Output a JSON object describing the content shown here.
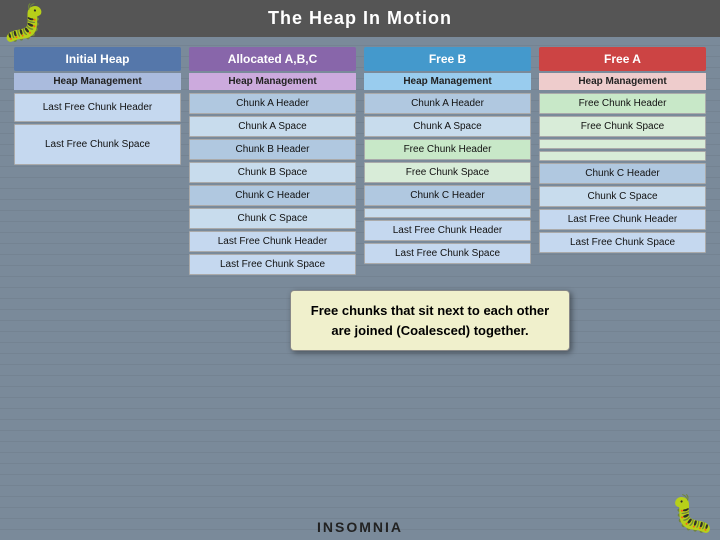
{
  "title": "The Heap In Motion",
  "columns": [
    {
      "id": "initial",
      "header": "Initial Heap",
      "header_class": "initial",
      "mgmt": "Heap Management",
      "mgmt_class": "initial",
      "cells": [
        {
          "text": "Last Free Chunk Header",
          "class": "cell light-blue tall"
        },
        {
          "text": "Last Free Chunk Space",
          "class": "cell light-blue taller"
        }
      ]
    },
    {
      "id": "allocated",
      "header": "Allocated A,B,C",
      "header_class": "allocated",
      "mgmt": "Heap Management",
      "mgmt_class": "allocated",
      "cells": [
        {
          "text": "Chunk A Header",
          "class": "cell chunk-header"
        },
        {
          "text": "Chunk A Space",
          "class": "cell chunk-space"
        },
        {
          "text": "Chunk B Header",
          "class": "cell chunk-header"
        },
        {
          "text": "Chunk B Space",
          "class": "cell chunk-space"
        },
        {
          "text": "Chunk C Header",
          "class": "cell chunk-header"
        },
        {
          "text": "Chunk C Space",
          "class": "cell chunk-space"
        },
        {
          "text": "Last Free Chunk Header",
          "class": "cell light-blue"
        },
        {
          "text": "Last Free Chunk Space",
          "class": "cell light-blue"
        }
      ]
    },
    {
      "id": "free-b",
      "header": "Free B",
      "header_class": "free-b",
      "mgmt": "Heap Management",
      "mgmt_class": "free-b",
      "cells": [
        {
          "text": "Chunk A Header",
          "class": "cell chunk-header"
        },
        {
          "text": "Chunk A Space",
          "class": "cell chunk-space"
        },
        {
          "text": "Free Chunk Header",
          "class": "cell free-chunk-header"
        },
        {
          "text": "Free Chunk Space",
          "class": "cell free-chunk-space"
        },
        {
          "text": "Chunk C Header",
          "class": "cell chunk-header"
        },
        {
          "text": "",
          "class": "cell chunk-space"
        },
        {
          "text": "Last Free Chunk Header",
          "class": "cell light-blue"
        },
        {
          "text": "Last Free Chunk Space",
          "class": "cell light-blue"
        }
      ]
    },
    {
      "id": "free-a",
      "header": "Free A",
      "header_class": "free-a",
      "mgmt": "Heap Management",
      "mgmt_class": "free-a",
      "cells": [
        {
          "text": "Free Chunk Header",
          "class": "cell free-chunk-header"
        },
        {
          "text": "Free Chunk Space",
          "class": "cell free-chunk-space"
        },
        {
          "text": "",
          "class": "cell free-chunk-space"
        },
        {
          "text": "",
          "class": "cell free-chunk-space"
        },
        {
          "text": "Chunk C Header",
          "class": "cell chunk-header"
        },
        {
          "text": "Chunk C Space",
          "class": "cell chunk-space"
        },
        {
          "text": "Last Free Chunk Header",
          "class": "cell light-blue"
        },
        {
          "text": "Last Free Chunk Space",
          "class": "cell light-blue"
        }
      ]
    }
  ],
  "tooltip": {
    "text": "Free chunks that sit next to each other are joined (Coalesced) together."
  },
  "footer": "INSOMNIA",
  "bugs": {
    "symbol": "🐛"
  }
}
